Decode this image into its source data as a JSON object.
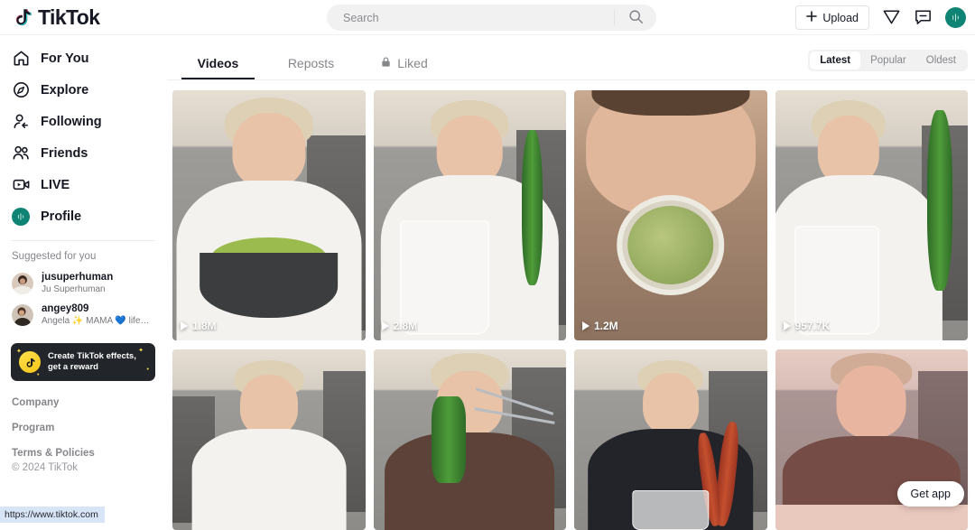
{
  "header": {
    "logo_text": "TikTok",
    "logo_icon": "tiktok-note-icon",
    "search": {
      "placeholder": "Search",
      "value": "",
      "icon": "search-icon"
    },
    "upload_label": "Upload",
    "upload_icon": "plus-icon",
    "inbox_icon": "paper-plane-icon",
    "messages_icon": "message-icon",
    "avatar_icon": "profile-avatar",
    "avatar_color": "#108474"
  },
  "sidebar": {
    "nav": [
      {
        "label": "For You",
        "icon": "home-icon"
      },
      {
        "label": "Explore",
        "icon": "compass-icon"
      },
      {
        "label": "Following",
        "icon": "user-follow-icon"
      },
      {
        "label": "Friends",
        "icon": "users-icon"
      },
      {
        "label": "LIVE",
        "icon": "live-video-icon"
      },
      {
        "label": "Profile",
        "icon": "profile-avatar-icon"
      }
    ],
    "suggested_title": "Suggested for you",
    "suggested": [
      {
        "name": "jusuperhuman",
        "subtitle": "Ju Superhuman"
      },
      {
        "name": "angey809",
        "subtitle": "Angela ✨ MAMA 💙 lifesty..."
      }
    ],
    "promo": {
      "line1": "Create TikTok effects,",
      "line2": "get a reward",
      "icon": "tiktok-coin-icon"
    },
    "footer": {
      "links": [
        "Company",
        "Program",
        "Terms & Policies"
      ],
      "copyright": "© 2024 TikTok"
    }
  },
  "main": {
    "tabs": [
      {
        "label": "Videos",
        "active": true,
        "icon": ""
      },
      {
        "label": "Reposts",
        "active": false,
        "icon": ""
      },
      {
        "label": "Liked",
        "active": false,
        "icon": "lock-icon"
      }
    ],
    "sort_pills": [
      {
        "label": "Latest",
        "active": true
      },
      {
        "label": "Popular",
        "active": false
      },
      {
        "label": "Oldest",
        "active": false
      }
    ],
    "videos_row1": [
      {
        "views": "1.8M",
        "scene": "salad-bowl"
      },
      {
        "views": "2.8M",
        "scene": "cucumber-glass"
      },
      {
        "views": "1.2M",
        "scene": "pickle-jar"
      },
      {
        "views": "957.7K",
        "scene": "big-cucumber"
      }
    ],
    "videos_row2": [
      {
        "views": "",
        "scene": "white-shirt-eating"
      },
      {
        "views": "",
        "scene": "tongs-cucumber"
      },
      {
        "views": "",
        "scene": "sausages"
      },
      {
        "views": "",
        "scene": "pink-light"
      }
    ],
    "get_app_label": "Get app"
  },
  "browser": {
    "status_url": "https://www.tiktok.com"
  }
}
